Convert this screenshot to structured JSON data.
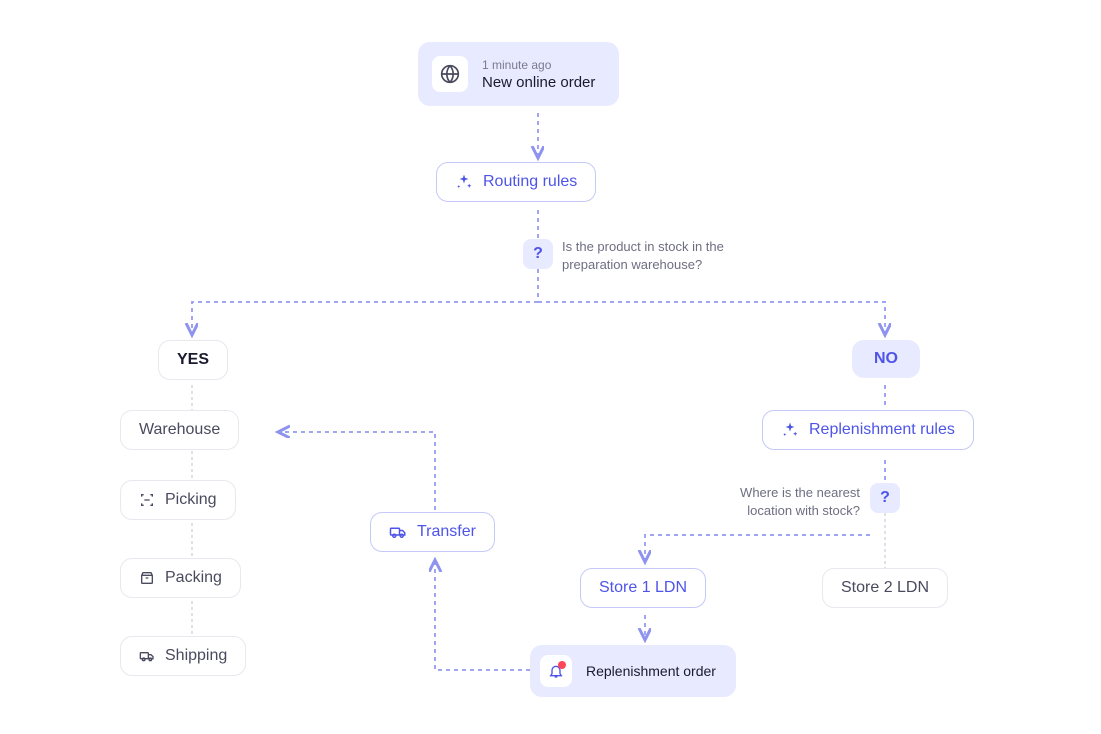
{
  "header": {
    "timestamp": "1 minute ago",
    "title": "New online order"
  },
  "nodes": {
    "routing_rules": "Routing rules",
    "replenishment_rules": "Replenishment rules",
    "yes": "YES",
    "no": "NO",
    "warehouse": "Warehouse",
    "picking": "Picking",
    "packing": "Packing",
    "shipping": "Shipping",
    "transfer": "Transfer",
    "store1": "Store 1 LDN",
    "store2": "Store 2 LDN",
    "replenishment_order": "Replenishment order"
  },
  "questions": {
    "q1": "Is the product in stock in the preparation warehouse?",
    "q2": "Where is the nearest location with stock?"
  }
}
